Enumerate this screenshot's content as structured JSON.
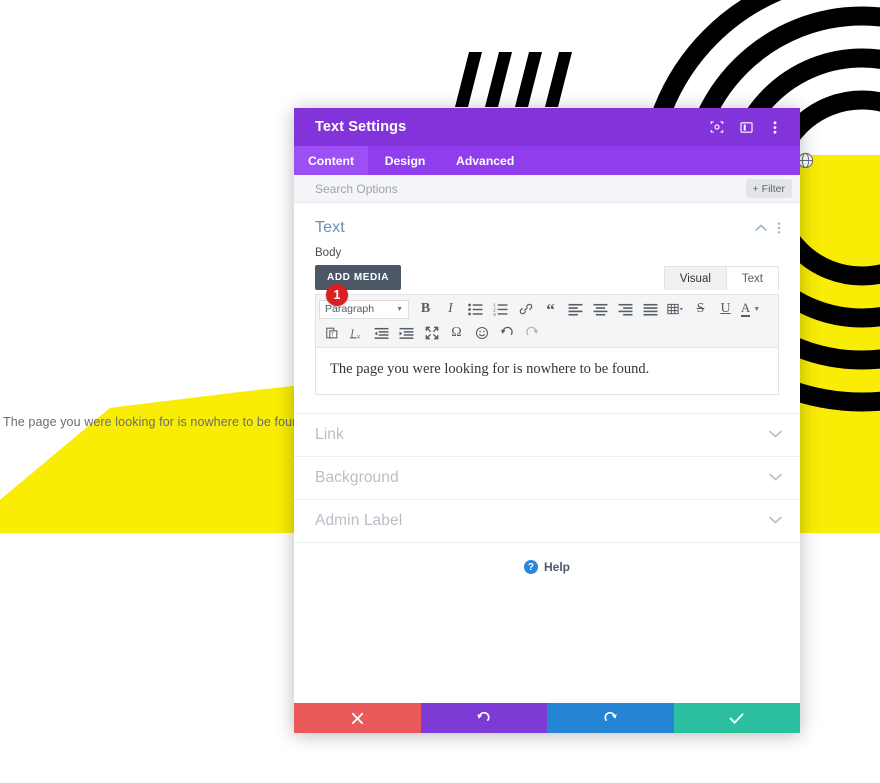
{
  "background": {
    "page_text": "The page you were looking for is nowhere to be found.",
    "yellow_color": "#f9ed05",
    "ring_color": "#000000",
    "stripe_color": "#000000",
    "globe_icon": "globe-icon"
  },
  "modal": {
    "title": "Text Settings",
    "header_icons": [
      {
        "name": "focus-target-icon",
        "glyph": "target"
      },
      {
        "name": "layout-panel-icon",
        "glyph": "panel"
      },
      {
        "name": "more-options-icon",
        "glyph": "dots"
      }
    ],
    "tabs": [
      {
        "label": "Content",
        "active": true
      },
      {
        "label": "Design",
        "active": false
      },
      {
        "label": "Advanced",
        "active": false
      }
    ],
    "search": {
      "placeholder": "Search Options",
      "value": ""
    },
    "filter_button": {
      "label": "Filter",
      "plus": "+"
    },
    "section": {
      "title": "Text",
      "collapse_icon": "chevron-up-icon",
      "more_icon": "more-options-icon",
      "field_label": "Body",
      "add_media_label": "ADD MEDIA",
      "editor_tabs": [
        {
          "label": "Visual",
          "active": true
        },
        {
          "label": "Text",
          "active": false
        }
      ],
      "toolbar_row1": {
        "format_select": "Paragraph",
        "buttons": [
          {
            "name": "bold-icon",
            "title": "Bold"
          },
          {
            "name": "italic-icon",
            "title": "Italic"
          },
          {
            "name": "bulleted-list-icon",
            "title": "Bulleted list"
          },
          {
            "name": "numbered-list-icon",
            "title": "Numbered list"
          },
          {
            "name": "link-icon",
            "title": "Insert link"
          },
          {
            "name": "blockquote-icon",
            "title": "Blockquote"
          },
          {
            "name": "align-left-icon",
            "title": "Align left"
          },
          {
            "name": "align-center-icon",
            "title": "Align center"
          },
          {
            "name": "align-right-icon",
            "title": "Align right"
          },
          {
            "name": "align-justify-icon",
            "title": "Justify"
          },
          {
            "name": "table-icon",
            "title": "Table"
          },
          {
            "name": "strikethrough-icon",
            "title": "Strikethrough"
          },
          {
            "name": "underline-icon",
            "title": "Underline"
          },
          {
            "name": "text-color-icon",
            "title": "Text color"
          }
        ]
      },
      "toolbar_row2": {
        "buttons": [
          {
            "name": "paste-as-text-icon",
            "title": "Paste as text"
          },
          {
            "name": "clear-formatting-icon",
            "title": "Clear formatting"
          },
          {
            "name": "outdent-icon",
            "title": "Decrease indent"
          },
          {
            "name": "indent-icon",
            "title": "Increase indent"
          },
          {
            "name": "fullscreen-icon",
            "title": "Fullscreen"
          },
          {
            "name": "special-character-icon",
            "title": "Special character"
          },
          {
            "name": "emoji-icon",
            "title": "Emoji"
          },
          {
            "name": "undo-icon",
            "title": "Undo"
          },
          {
            "name": "redo-icon",
            "title": "Redo"
          }
        ]
      },
      "editor_content": "The page you were looking for is nowhere to be found.",
      "badge_number": "1"
    },
    "accordions": [
      {
        "title": "Link",
        "icon": "chevron-down-icon"
      },
      {
        "title": "Background",
        "icon": "chevron-down-icon"
      },
      {
        "title": "Admin Label",
        "icon": "chevron-down-icon"
      }
    ],
    "help": {
      "label": "Help",
      "icon_glyph": "?"
    },
    "footer_buttons": [
      {
        "name": "cancel-button",
        "icon": "close-icon",
        "color": "#eb5a5a"
      },
      {
        "name": "undo-button",
        "icon": "undo-icon",
        "color": "#7d3ad4"
      },
      {
        "name": "redo-button",
        "icon": "redo-icon",
        "color": "#2585d4"
      },
      {
        "name": "save-button",
        "icon": "check-icon",
        "color": "#2bbfa0"
      }
    ],
    "colors": {
      "header_purple": "#8333da",
      "tabs_purple": "#8f3ded",
      "tab_active_purple": "#9b4ff5",
      "add_media": "#4c5866",
      "section_title": "#6c8faf",
      "badge_red": "#d91f1f"
    }
  }
}
